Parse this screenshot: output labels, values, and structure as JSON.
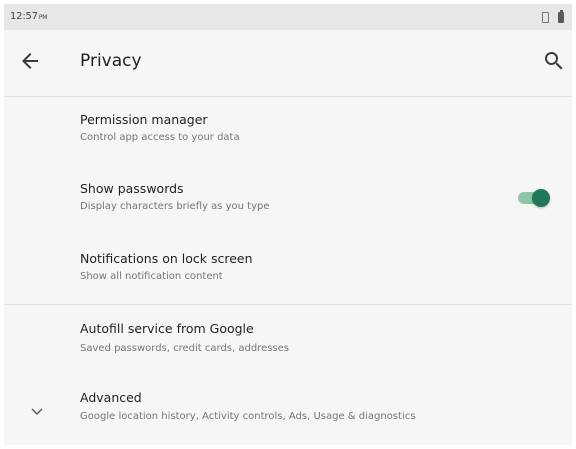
{
  "status_bar": {
    "time": "12:57",
    "ampm": "PM",
    "icons": [
      "vibrate-icon",
      "battery-icon"
    ]
  },
  "app_bar": {
    "title": "Privacy",
    "back_icon": "arrow-left-icon",
    "search_icon": "search-icon"
  },
  "preferences": [
    {
      "title": "Permission manager",
      "summary": "Control app access to your data"
    },
    {
      "title": "Show passwords",
      "summary": "Display characters briefly as you type",
      "toggle": "on"
    },
    {
      "title": "Notifications on lock screen",
      "summary": "Show all notification content"
    },
    {
      "title": "Autofill service from Google",
      "summary": "Saved passwords, credit cards, addresses"
    },
    {
      "title": "Advanced",
      "summary": "Google location history, Activity controls, Ads, Usage & diagnostics",
      "icon": "chevron-down-icon"
    }
  ],
  "colors": {
    "accent": "#21775a",
    "accent_track": "#8dc5ac",
    "background": "#f6f6f6",
    "status_bar": "#e7e7e7"
  }
}
